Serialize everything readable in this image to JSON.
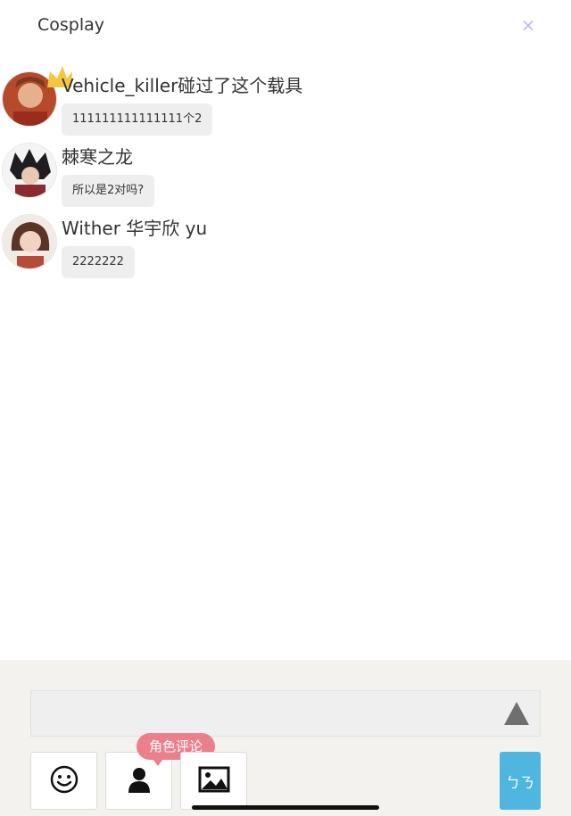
{
  "header": {
    "title": "Cosplay",
    "close_glyph": "×"
  },
  "messages": [
    {
      "user": "Vehicle_killer碰过了这个载具",
      "text": "111111111111111个2",
      "avatar": "avatar-warrior",
      "badge": "crown-icon"
    },
    {
      "user": "棘寒之龙",
      "text": "所以是2对吗?",
      "avatar": "avatar-dark-hair"
    },
    {
      "user": "Wither 华宇欣 yu",
      "text": "2222222",
      "avatar": "avatar-girl"
    }
  ],
  "composer": {
    "input_value": "",
    "send_icon": "triangle-up-icon",
    "tools": [
      {
        "name": "emoji",
        "icon": "smiley-icon"
      },
      {
        "name": "role",
        "icon": "person-icon",
        "tooltip": "角色评论"
      },
      {
        "name": "image",
        "icon": "image-icon"
      }
    ],
    "side_button_label": "ㄅㄋ"
  },
  "colors": {
    "accent_pink": "#ec7f8c",
    "accent_blue": "#4fb6e0",
    "close_purple": "#c9b6e8"
  }
}
